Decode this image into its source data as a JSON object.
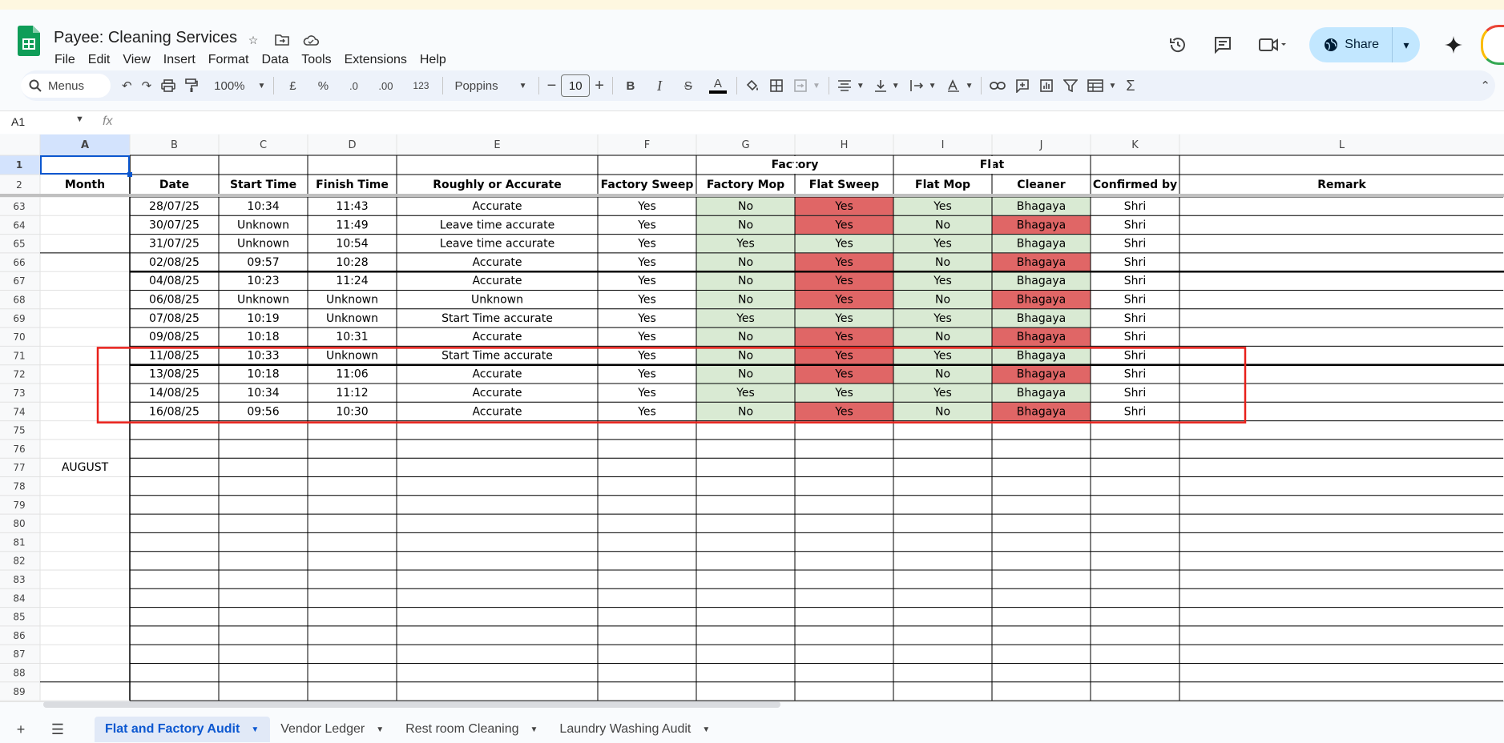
{
  "document": {
    "title": "Payee: Cleaning Services"
  },
  "menu": [
    "File",
    "Edit",
    "View",
    "Insert",
    "Format",
    "Data",
    "Tools",
    "Extensions",
    "Help"
  ],
  "toolbar": {
    "search": "Menus",
    "zoom": "100%",
    "currency": "£",
    "percent": "%",
    "dec_decrease": ".0",
    "dec_increase": ".00",
    "number_format": "123",
    "font": "Poppins",
    "font_size": "10"
  },
  "share": {
    "label": "Share"
  },
  "formula_bar": {
    "cell_ref": "A1",
    "fx": "fx"
  },
  "columns": [
    "A",
    "B",
    "C",
    "D",
    "E",
    "F",
    "G",
    "H",
    "I",
    "J",
    "K",
    "L"
  ],
  "header_rows": {
    "row1_groups": {
      "factory": "Factory",
      "flat": "Flat"
    },
    "row2": [
      "Month",
      "Date",
      "Start Time",
      "Finish Time",
      "Roughly or Accurate",
      "Factory Sweep",
      "Factory Mop",
      "Flat Sweep",
      "Flat Mop",
      "Cleaner",
      "Confirmed by",
      "Remark"
    ]
  },
  "row_numbers_header": [
    "1",
    "2"
  ],
  "month_label": "AUGUST",
  "rows": [
    {
      "n": "63",
      "date": "28/07/25",
      "start": "10:34",
      "finish": "11:43",
      "accuracy": "Accurate",
      "f_sweep": "Yes",
      "f_mop": "No",
      "fl_sweep": "Yes",
      "fl_mop": "Yes",
      "cleaner": "Bhagaya",
      "confirmed": "Shri"
    },
    {
      "n": "64",
      "date": "30/07/25",
      "start": "Unknown",
      "finish": "11:49",
      "accuracy": "Leave time accurate",
      "f_sweep": "Yes",
      "f_mop": "No",
      "fl_sweep": "Yes",
      "fl_mop": "No",
      "cleaner": "Bhagaya",
      "confirmed": "Shri"
    },
    {
      "n": "65",
      "date": "31/07/25",
      "start": "Unknown",
      "finish": "10:54",
      "accuracy": "Leave time accurate",
      "f_sweep": "Yes",
      "f_mop": "Yes",
      "fl_sweep": "Yes",
      "fl_mop": "Yes",
      "cleaner": "Bhagaya",
      "confirmed": "Shri"
    },
    {
      "n": "66",
      "date": "02/08/25",
      "start": "09:57",
      "finish": "10:28",
      "accuracy": "Accurate",
      "f_sweep": "Yes",
      "f_mop": "No",
      "fl_sweep": "Yes",
      "fl_mop": "No",
      "cleaner": "Bhagaya",
      "confirmed": "Shri"
    },
    {
      "n": "67",
      "date": "04/08/25",
      "start": "10:23",
      "finish": "11:24",
      "accuracy": "Accurate",
      "f_sweep": "Yes",
      "f_mop": "No",
      "fl_sweep": "Yes",
      "fl_mop": "Yes",
      "cleaner": "Bhagaya",
      "confirmed": "Shri"
    },
    {
      "n": "68",
      "date": "06/08/25",
      "start": "Unknown",
      "finish": "Unknown",
      "accuracy": "Unknown",
      "f_sweep": "Yes",
      "f_mop": "No",
      "fl_sweep": "Yes",
      "fl_mop": "No",
      "cleaner": "Bhagaya",
      "confirmed": "Shri"
    },
    {
      "n": "69",
      "date": "07/08/25",
      "start": "10:19",
      "finish": "Unknown",
      "accuracy": "Start Time accurate",
      "f_sweep": "Yes",
      "f_mop": "Yes",
      "fl_sweep": "Yes",
      "fl_mop": "Yes",
      "cleaner": "Bhagaya",
      "confirmed": "Shri"
    },
    {
      "n": "70",
      "date": "09/08/25",
      "start": "10:18",
      "finish": "10:31",
      "accuracy": "Accurate",
      "f_sweep": "Yes",
      "f_mop": "No",
      "fl_sweep": "Yes",
      "fl_mop": "No",
      "cleaner": "Bhagaya",
      "confirmed": "Shri"
    },
    {
      "n": "71",
      "date": "11/08/25",
      "start": "10:33",
      "finish": "Unknown",
      "accuracy": "Start Time accurate",
      "f_sweep": "Yes",
      "f_mop": "No",
      "fl_sweep": "Yes",
      "fl_mop": "Yes",
      "cleaner": "Bhagaya",
      "confirmed": "Shri"
    },
    {
      "n": "72",
      "date": "13/08/25",
      "start": "10:18",
      "finish": "11:06",
      "accuracy": "Accurate",
      "f_sweep": "Yes",
      "f_mop": "No",
      "fl_sweep": "Yes",
      "fl_mop": "No",
      "cleaner": "Bhagaya",
      "confirmed": "Shri"
    },
    {
      "n": "73",
      "date": "14/08/25",
      "start": "10:34",
      "finish": "11:12",
      "accuracy": "Accurate",
      "f_sweep": "Yes",
      "f_mop": "Yes",
      "fl_sweep": "Yes",
      "fl_mop": "Yes",
      "cleaner": "Bhagaya",
      "confirmed": "Shri"
    },
    {
      "n": "74",
      "date": "16/08/25",
      "start": "09:56",
      "finish": "10:30",
      "accuracy": "Accurate",
      "f_sweep": "Yes",
      "f_mop": "No",
      "fl_sweep": "Yes",
      "fl_mop": "No",
      "cleaner": "Bhagaya",
      "confirmed": "Shri"
    }
  ],
  "empty_row_numbers": [
    "75",
    "76",
    "77",
    "78",
    "79",
    "80",
    "81",
    "82",
    "83",
    "84",
    "85",
    "86",
    "87",
    "88",
    "89"
  ],
  "sheets": [
    {
      "label": "Flat and Factory Audit",
      "active": true
    },
    {
      "label": "Vendor Ledger",
      "active": false
    },
    {
      "label": "Rest room Cleaning",
      "active": false
    },
    {
      "label": "Laundry Washing Audit",
      "active": false
    }
  ],
  "colors": {
    "yes_fill": "#d9ead3",
    "no_fill": "#e06666",
    "highlight_box": "#e8201a",
    "accent": "#0b57d0",
    "header_fill": "#f8f9fa",
    "selected_header": "#d3e3fd"
  }
}
